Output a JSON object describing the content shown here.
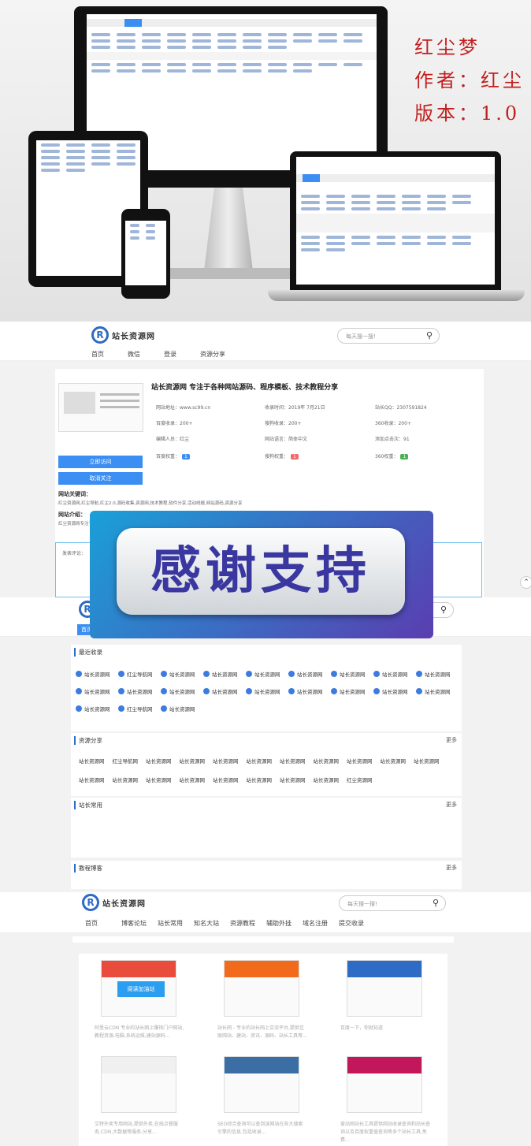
{
  "hero": {
    "title": "红尘梦",
    "author": "作者：红尘",
    "version": "版本：1.0"
  },
  "site": {
    "logo_text": "站长资源网",
    "search_placeholder": "每天搜一搜!"
  },
  "detail": {
    "nav": [
      "首页",
      "微信",
      "登录",
      "资源分享"
    ],
    "site_title": "站长资源网 专注于各种网站源码、程序模板、技术教程分享",
    "fields": [
      [
        "网站地址：www.sc99.cn",
        "收录时间：2019年 7月21日",
        "站长QQ：2307591824"
      ],
      [
        "百度收录：200+",
        "搜狗收录：200+",
        "360收录：200+"
      ],
      [
        "编辑人员：红尘",
        "网站语言：简体中文",
        "添加点击次：91"
      ],
      [
        "百度权重：",
        "搜狗权重：",
        "360权重："
      ]
    ],
    "weights": [
      "1",
      "1",
      "1"
    ],
    "buttons": [
      "立即访问",
      "取消关注"
    ],
    "kw_label": "网站关键词：",
    "keywords": "红尘资源网,红尘导航,红尘2.0,源码收集,资源网,技术教程,软件分享,活动线报,网站源码,资源分享",
    "intro_label": "网站介绍：",
    "intro": "红尘资源网专注于...",
    "comment_label": "发表评论："
  },
  "overlay": {
    "text": "感谢支持"
  },
  "list": {
    "nav_item": "首页",
    "recent": {
      "title": "最近收录",
      "items": [
        "站长资源网",
        "红尘导航网",
        "站长资源网",
        "站长资源网",
        "站长资源网",
        "站长资源网",
        "站长资源网",
        "站长资源网",
        "站长资源网",
        "站长资源网",
        "站长资源网",
        "站长资源网",
        "站长资源网",
        "站长资源网",
        "站长资源网",
        "站长资源网",
        "站长资源网",
        "站长资源网",
        "站长资源网",
        "红尘导航网",
        "站长资源网"
      ]
    },
    "share": {
      "title": "资源分享",
      "more": "更多",
      "items": [
        "站长资源网",
        "红尘导航网",
        "站长资源网",
        "站长资源网",
        "站长资源网",
        "站长资源网",
        "站长资源网",
        "站长资源网",
        "站长资源网",
        "站长资源网",
        "站长资源网",
        "站长资源网",
        "站长资源网",
        "站长资源网",
        "站长资源网",
        "站长资源网",
        "站长资源网",
        "站长资源网",
        "站长资源网",
        "红尘资源网"
      ]
    },
    "tools": {
      "title": "站长常用",
      "more": "更多"
    },
    "tutorial": {
      "title": "教程博客",
      "more": "更多"
    }
  },
  "blog": {
    "nav": [
      "首页",
      "博客论坛",
      "站长常用",
      "知名大站",
      "资源教程",
      "辅助外挂",
      "域名注册",
      "提交收录"
    ],
    "cards": [
      {
        "text": "阿里云CDN 专业的站长网上赚钱门户网站,教程资源,电脑,系统运维,建站源码..."
      },
      {
        "text": "站长网 - 专业的站长网上交流平台,提供互联网站、建站、资讯、源码、站长工具等..."
      },
      {
        "text": "百度一下，你就知道"
      },
      {
        "text": "艾特外卖专用网站,提供外卖,在线点餐服务,CDN,大数据等服务,分享..."
      },
      {
        "text": "SEO综合查询可以查到该网站在各大搜索引擎的信息,包括收录..."
      },
      {
        "text": "爱站网站长工具提供网站收录查询和站长查询以及百度权重值查询等多个站长工具,免费..."
      }
    ],
    "banner_text": "阅读加油站"
  },
  "colors": {
    "brand": "#2d6bc4",
    "button": "#3b8ef2",
    "hero_red": "#c21f1f",
    "overlay_text": "#3a38a0"
  }
}
